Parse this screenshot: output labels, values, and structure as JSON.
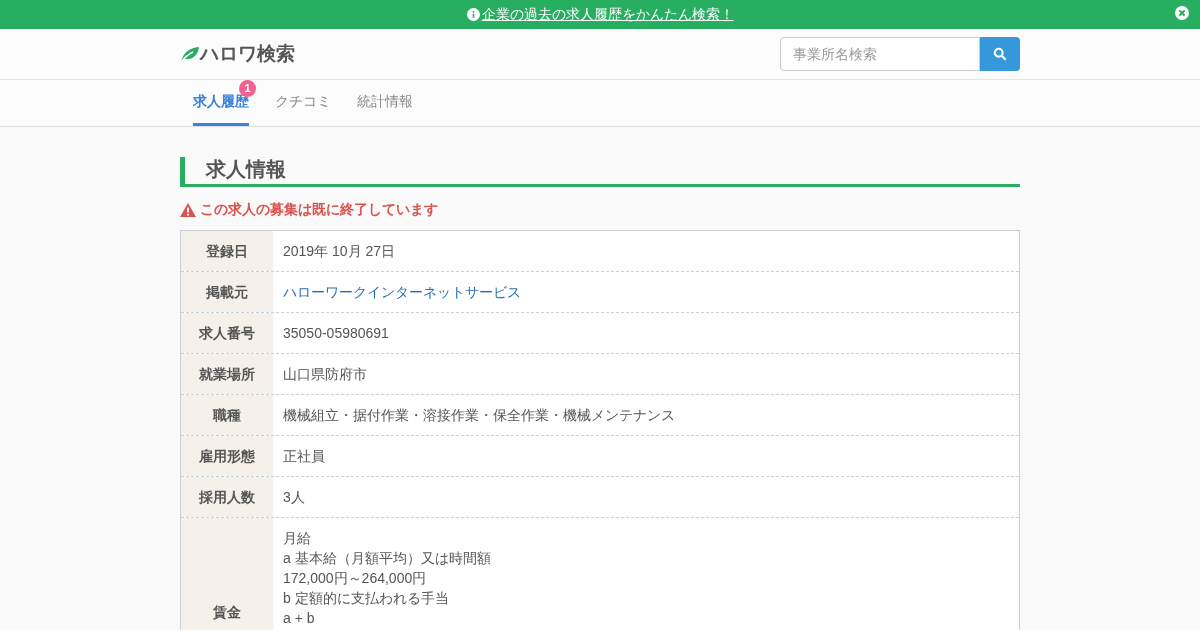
{
  "banner": {
    "text": "企業の過去の求人履歴をかんたん検索！"
  },
  "header": {
    "logo": "ハロワ検索",
    "search": {
      "placeholder": "事業所名検索"
    }
  },
  "tabs": [
    {
      "label": "求人履歴",
      "selected": true,
      "badge": "1"
    },
    {
      "label": "クチコミ",
      "selected": false
    },
    {
      "label": "統計情報",
      "selected": false
    }
  ],
  "section_title": "求人情報",
  "warning": "この求人の募集は既に終了しています",
  "rows": [
    {
      "label": "登録日",
      "kind": "text",
      "value": "2019年 10月 27日"
    },
    {
      "label": "掲載元",
      "kind": "link",
      "value": "ハローワークインターネットサービス"
    },
    {
      "label": "求人番号",
      "kind": "text",
      "value": "35050-05980691"
    },
    {
      "label": "就業場所",
      "kind": "text",
      "value": "山口県防府市"
    },
    {
      "label": "職種",
      "kind": "text",
      "value": "機械組立・据付作業・溶接作業・保全作業・機械メンテナンス"
    },
    {
      "label": "雇用形態",
      "kind": "text",
      "value": "正社員"
    },
    {
      "label": "採用人数",
      "kind": "text",
      "value": "3人"
    },
    {
      "label": "賃金",
      "kind": "lines",
      "lines": [
        "月給",
        "a 基本給（月額平均）又は時間額",
        "172,000円～264,000円",
        "b 定額的に支払われる手当",
        "a + b"
      ]
    }
  ]
}
